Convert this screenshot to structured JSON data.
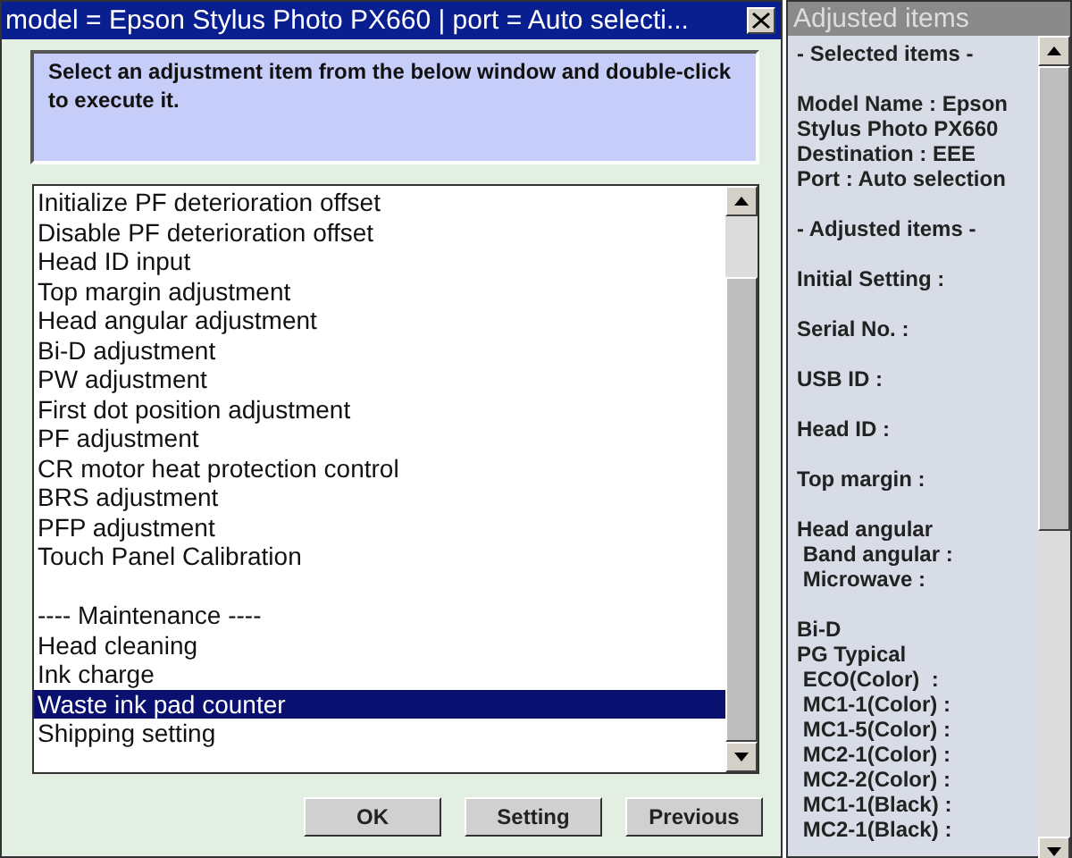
{
  "window": {
    "title": "model = Epson Stylus Photo PX660 | port = Auto selecti..."
  },
  "instruction": "Select an adjustment item from the below window and double-click to execute it.",
  "list": {
    "groups": [
      [
        {
          "label": "Initialize PF deterioration offset",
          "selected": false
        },
        {
          "label": "Disable PF deterioration offset",
          "selected": false
        },
        {
          "label": "Head ID input",
          "selected": false
        },
        {
          "label": "Top margin adjustment",
          "selected": false
        },
        {
          "label": "Head angular adjustment",
          "selected": false
        },
        {
          "label": "Bi-D adjustment",
          "selected": false
        },
        {
          "label": "PW adjustment",
          "selected": false
        },
        {
          "label": "First dot position adjustment",
          "selected": false
        },
        {
          "label": "PF adjustment",
          "selected": false
        },
        {
          "label": "CR motor heat protection control",
          "selected": false
        },
        {
          "label": "BRS adjustment",
          "selected": false
        },
        {
          "label": "PFP adjustment",
          "selected": false
        },
        {
          "label": "Touch Panel Calibration",
          "selected": false
        }
      ],
      [
        {
          "label": "---- Maintenance ----",
          "selected": false
        },
        {
          "label": "Head cleaning",
          "selected": false
        },
        {
          "label": "Ink charge",
          "selected": false
        },
        {
          "label": "Waste ink pad counter",
          "selected": true
        },
        {
          "label": "Shipping setting",
          "selected": false
        }
      ]
    ]
  },
  "buttons": [
    "OK",
    "Setting",
    "Previous"
  ],
  "side_panel": {
    "title": "Adjusted items",
    "groups": [
      [
        "- Selected items -"
      ],
      [
        "Model Name : Epson",
        "Stylus Photo PX660",
        "Destination : EEE",
        "Port : Auto selection"
      ],
      [
        "- Adjusted items -"
      ],
      [
        "Initial Setting :"
      ],
      [
        "Serial No. :"
      ],
      [
        "USB ID :"
      ],
      [
        "Head ID :"
      ],
      [
        "Top margin :"
      ],
      [
        "Head angular",
        " Band angular :",
        " Microwave :"
      ],
      [
        "Bi-D",
        "PG Typical",
        " ECO(Color)  :",
        " MC1-1(Color) :",
        " MC1-5(Color) :",
        " MC2-1(Color) :",
        " MC2-2(Color) :",
        " MC1-1(Black) :",
        " MC2-1(Black) :"
      ]
    ]
  }
}
